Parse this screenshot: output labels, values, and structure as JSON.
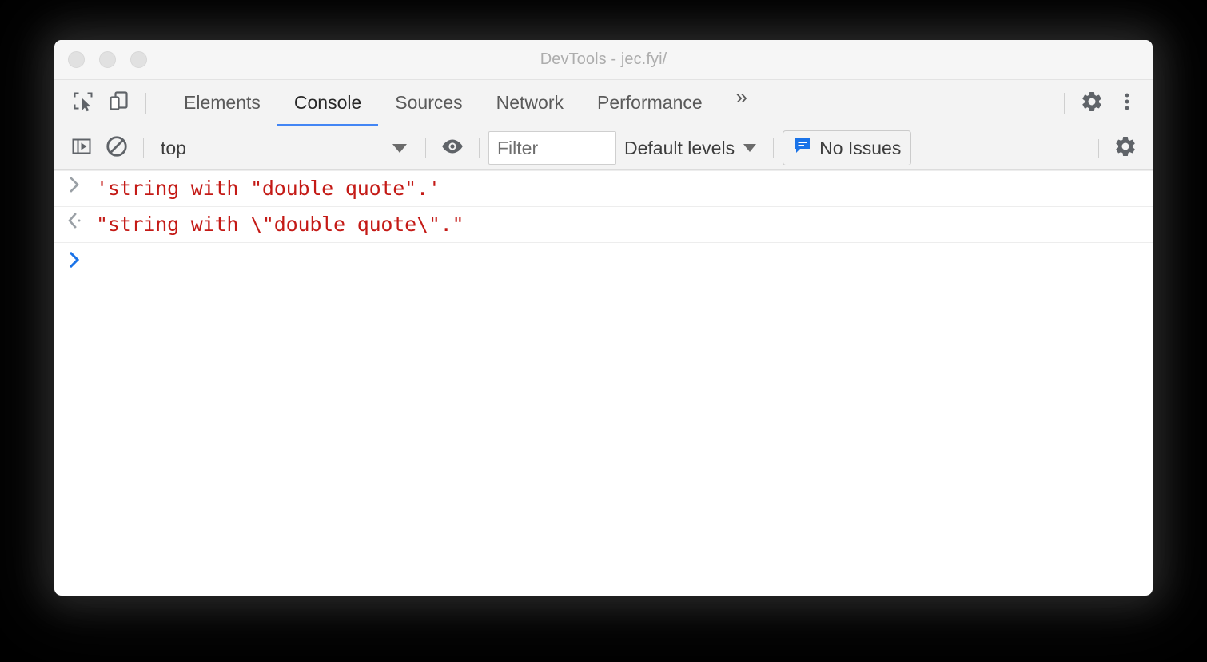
{
  "window": {
    "title": "DevTools - jec.fyi/",
    "traffic_lights": [
      "close",
      "minimize",
      "maximize"
    ]
  },
  "tabbar": {
    "inspect_icon": "inspect-cursor-icon",
    "device_icon": "device-toolbar-icon",
    "tabs": [
      {
        "label": "Elements",
        "active": false
      },
      {
        "label": "Console",
        "active": true
      },
      {
        "label": "Sources",
        "active": false
      },
      {
        "label": "Network",
        "active": false
      },
      {
        "label": "Performance",
        "active": false
      }
    ],
    "more_tabs_label": "»",
    "settings_icon": "gear-icon",
    "menu_icon": "more-vertical-icon"
  },
  "console_toolbar": {
    "sidebar_toggle_icon": "console-sidebar-icon",
    "clear_console_icon": "clear-console-icon",
    "context": {
      "value": "top",
      "caret_icon": "chevron-down-icon"
    },
    "live_expression_icon": "eye-icon",
    "filter": {
      "value": "",
      "placeholder": "Filter"
    },
    "levels": {
      "label": "Default levels",
      "caret_icon": "chevron-down-icon"
    },
    "issues": {
      "label": "No Issues",
      "icon": "issues-bubble-icon",
      "icon_color": "#1a73e8"
    },
    "settings_icon": "gear-icon"
  },
  "console": {
    "rows": [
      {
        "type": "input",
        "gutter_icon": "input-chevron-icon",
        "text": "'string with \"double quote\".'"
      },
      {
        "type": "result",
        "gutter_icon": "result-chevron-icon",
        "text": "\"string with \\\"double quote\\\".\""
      }
    ],
    "prompt": {
      "caret": ">",
      "value": ""
    },
    "string_color": "#c41a16"
  },
  "colors": {
    "accent": "#4285f4",
    "link_blue": "#1a73e8",
    "toolbar_bg": "#f3f3f3",
    "titlebar_bg": "#f6f6f6",
    "text": "#3c3c3c"
  }
}
